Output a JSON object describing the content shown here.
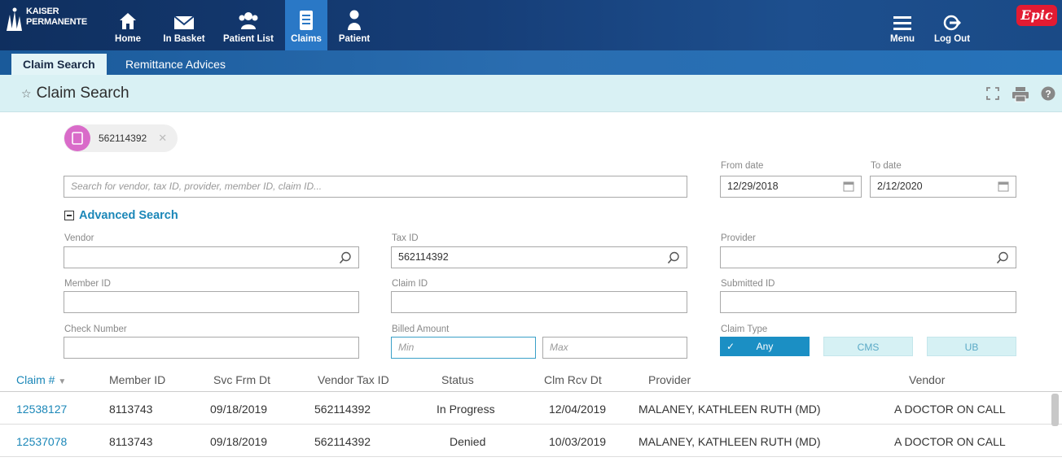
{
  "brand": {
    "line1": "KAISER",
    "line2": "PERMANENTE",
    "epic": "Epic"
  },
  "nav": {
    "home": "Home",
    "in_basket": "In Basket",
    "patient_list": "Patient List",
    "claims": "Claims",
    "patient": "Patient",
    "menu": "Menu",
    "log_out": "Log Out"
  },
  "tabs": {
    "claim_search": "Claim Search",
    "remittance": "Remittance Advices"
  },
  "page": {
    "title": "Claim Search"
  },
  "chip": {
    "text": "562114392"
  },
  "search": {
    "placeholder": "Search for vendor, tax ID, provider, member ID, claim ID...",
    "from_label": "From date",
    "from_value": "12/29/2018",
    "to_label": "To date",
    "to_value": "2/12/2020"
  },
  "advanced": {
    "title": "Advanced Search",
    "vendor_label": "Vendor",
    "vendor_value": "",
    "tax_id_label": "Tax ID",
    "tax_id_value": "562114392",
    "provider_label": "Provider",
    "provider_value": "",
    "member_id_label": "Member ID",
    "claim_id_label": "Claim ID",
    "submitted_id_label": "Submitted ID",
    "check_number_label": "Check Number",
    "billed_amount_label": "Billed Amount",
    "min_placeholder": "Min",
    "max_placeholder": "Max",
    "claim_type_label": "Claim Type",
    "claim_type_any": "Any",
    "claim_type_cms": "CMS",
    "claim_type_ub": "UB"
  },
  "table": {
    "headers": {
      "claim": "Claim #",
      "member_id": "Member ID",
      "svc_frm_dt": "Svc Frm Dt",
      "vendor_tax_id": "Vendor Tax ID",
      "status": "Status",
      "clm_rcv_dt": "Clm Rcv Dt",
      "provider": "Provider",
      "vendor": "Vendor"
    },
    "rows": [
      {
        "claim": "12538127",
        "member_id": "8113743",
        "svc_frm_dt": "09/18/2019",
        "vendor_tax_id": "562114392",
        "status": "In Progress",
        "clm_rcv_dt": "12/04/2019",
        "provider": "MALANEY, KATHLEEN RUTH (MD)",
        "vendor": "A DOCTOR ON CALL"
      },
      {
        "claim": "12537078",
        "member_id": "8113743",
        "svc_frm_dt": "09/18/2019",
        "vendor_tax_id": "562114392",
        "status": "Denied",
        "clm_rcv_dt": "10/03/2019",
        "provider": "MALANEY, KATHLEEN RUTH (MD)",
        "vendor": "A DOCTOR ON CALL"
      }
    ]
  },
  "colors": {
    "accent": "#1b87b8",
    "nav_bg": "#163e78",
    "title_bg": "#d9f1f4",
    "epic_red": "#e21b32",
    "chip_avatar": "#d96bc9"
  },
  "icons": [
    "kp-logo-icon",
    "home-icon",
    "envelope-icon",
    "patient-list-icon",
    "claims-icon",
    "patient-icon",
    "menu-icon",
    "logout-icon",
    "pin-icon",
    "fullscreen-icon",
    "print-icon",
    "help-icon",
    "document-icon",
    "close-icon",
    "calendar-icon",
    "search-icon",
    "sort-down-icon",
    "check-icon"
  ]
}
